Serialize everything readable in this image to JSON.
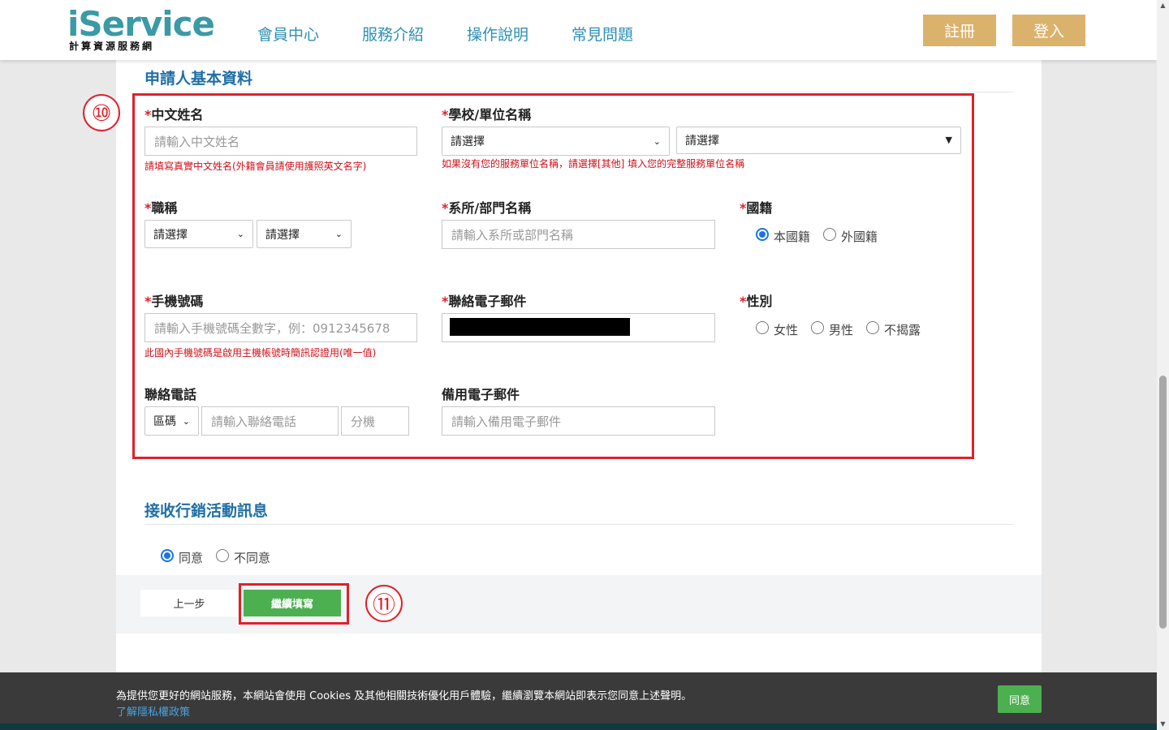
{
  "header": {
    "logo_main": "iService",
    "logo_sub": "計算資源服務網",
    "nav": [
      "會員中心",
      "服務介紹",
      "操作說明",
      "常見問題"
    ],
    "register": "註冊",
    "login": "登入"
  },
  "form": {
    "section_title": "申請人基本資料",
    "marker_form": "⑩",
    "chinese_name": {
      "label": "中文姓名",
      "placeholder": "請輸入中文姓名",
      "hint": "請填寫真實中文姓名(外籍會員請使用護照英文名字)"
    },
    "school": {
      "label": "學校/單位名稱",
      "select1": "請選擇",
      "select2": "請選擇",
      "hint": "如果沒有您的服務單位名稱，請選擇[其他] 填入您的完整服務單位名稱"
    },
    "title": {
      "label": "職稱",
      "select1": "請選擇",
      "select2": "請選擇"
    },
    "department": {
      "label": "系所/部門名稱",
      "placeholder": "請輸入系所或部門名稱"
    },
    "nationality": {
      "label": "國籍",
      "options": [
        "本國籍",
        "外國籍"
      ],
      "selected": "本國籍"
    },
    "mobile": {
      "label": "手機號碼",
      "placeholder": "請輸入手機號碼全數字，例：0912345678",
      "hint": "此國內手機號碼是啟用主機帳號時簡訊認證用(唯一值)"
    },
    "email": {
      "label": "聯絡電子郵件"
    },
    "gender": {
      "label": "性別",
      "options": [
        "女性",
        "男性",
        "不揭露"
      ]
    },
    "phone": {
      "label": "聯絡電話",
      "area_select": "區碼",
      "placeholder": "請輸入聯絡電話",
      "ext_placeholder": "分機"
    },
    "backup_email": {
      "label": "備用電子郵件",
      "placeholder": "請輸入備用電子郵件"
    }
  },
  "marketing": {
    "section_title": "接收行銷活動訊息",
    "options": [
      "同意",
      "不同意"
    ],
    "selected": "同意"
  },
  "actions": {
    "prev": "上一步",
    "next": "繼續填寫",
    "marker_next": "⑪"
  },
  "cookie": {
    "text": "為提供您更好的網站服務，本網站會使用 Cookies 及其他相關技術優化用戶體驗，繼續瀏覽本網站即表示您同意上述聲明。",
    "link": "了解隱私權政策",
    "agree": "同意"
  },
  "colors": {
    "brand_teal": "#3a9aa6",
    "nav_blue": "#2e8fb5",
    "gold": "#dbb26c",
    "green": "#4caf50",
    "annotation_red": "#e0202a"
  }
}
